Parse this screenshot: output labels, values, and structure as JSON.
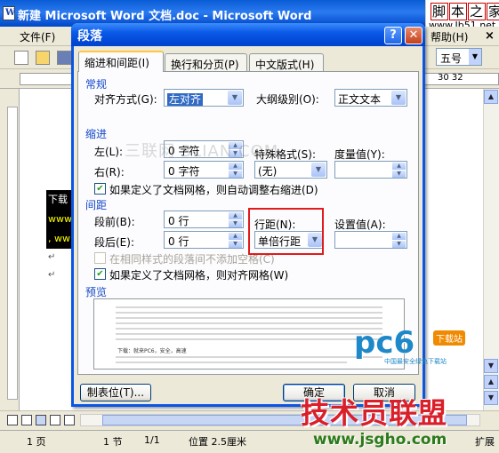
{
  "word": {
    "title": "新建 Microsoft Word 文档.doc - Microsoft Word",
    "menu_file": "文件(F)",
    "menu_help": "帮助(H)",
    "menu_close": "×",
    "font_size": "五号",
    "ruler_nums": "30  32",
    "doc_lines": [
      "下载",
      "www",
      ", ww"
    ],
    "status": {
      "page": "1 页",
      "section": "1 节",
      "page_of": "1/1",
      "position": "位置 2.5厘米",
      "ext": "扩展"
    }
  },
  "dialog": {
    "title": "段落",
    "help_btn": "?",
    "close_btn": "✕",
    "tabs": [
      {
        "label": "缩进和间距(I)",
        "active": true
      },
      {
        "label": "换行和分页(P)",
        "active": false
      },
      {
        "label": "中文版式(H)",
        "active": false
      }
    ],
    "general": {
      "section": "常规",
      "align_label": "对齐方式(G):",
      "align_value": "左对齐",
      "outline_label": "大纲级别(O):",
      "outline_value": "正文文本"
    },
    "indent": {
      "section": "缩进",
      "left_label": "左(L):",
      "left_value": "0 字符",
      "right_label": "右(R):",
      "right_value": "0 字符",
      "special_label": "特殊格式(S):",
      "special_value": "(无)",
      "measure_label": "度量值(Y):",
      "measure_value": "",
      "auto_adjust": "如果定义了文档网格，则自动调整右缩进(D)",
      "auto_adjust_checked": true
    },
    "spacing": {
      "section": "间距",
      "before_label": "段前(B):",
      "before_value": "0 行",
      "after_label": "段后(E):",
      "after_value": "0 行",
      "line_label": "行距(N):",
      "line_value": "单倍行距",
      "setting_label": "设置值(A):",
      "setting_value": "",
      "no_space_same_style": "在相同样式的段落间不添加空格(C)",
      "no_space_checked": false,
      "snap_grid": "如果定义了文档网格，则对齐网格(W)",
      "snap_grid_checked": true
    },
    "preview": {
      "section": "预览",
      "sample_text": "下载：就来PC6，安全，高速"
    },
    "buttons": {
      "tabs": "制表位(T)...",
      "ok": "确定",
      "cancel": "取消"
    }
  },
  "watermarks": {
    "site1": "三联网 3LIAN.COM",
    "jb51_main": "脚本之家",
    "jb51_sub": "www.Jb51.net",
    "pc6": "pc6",
    "pc6_badge": "下载站",
    "pc6_sub": "中国最安全绿色下载站",
    "jsgho_main": "技术员联盟",
    "jsgho_url": "www.jsgho.com"
  }
}
